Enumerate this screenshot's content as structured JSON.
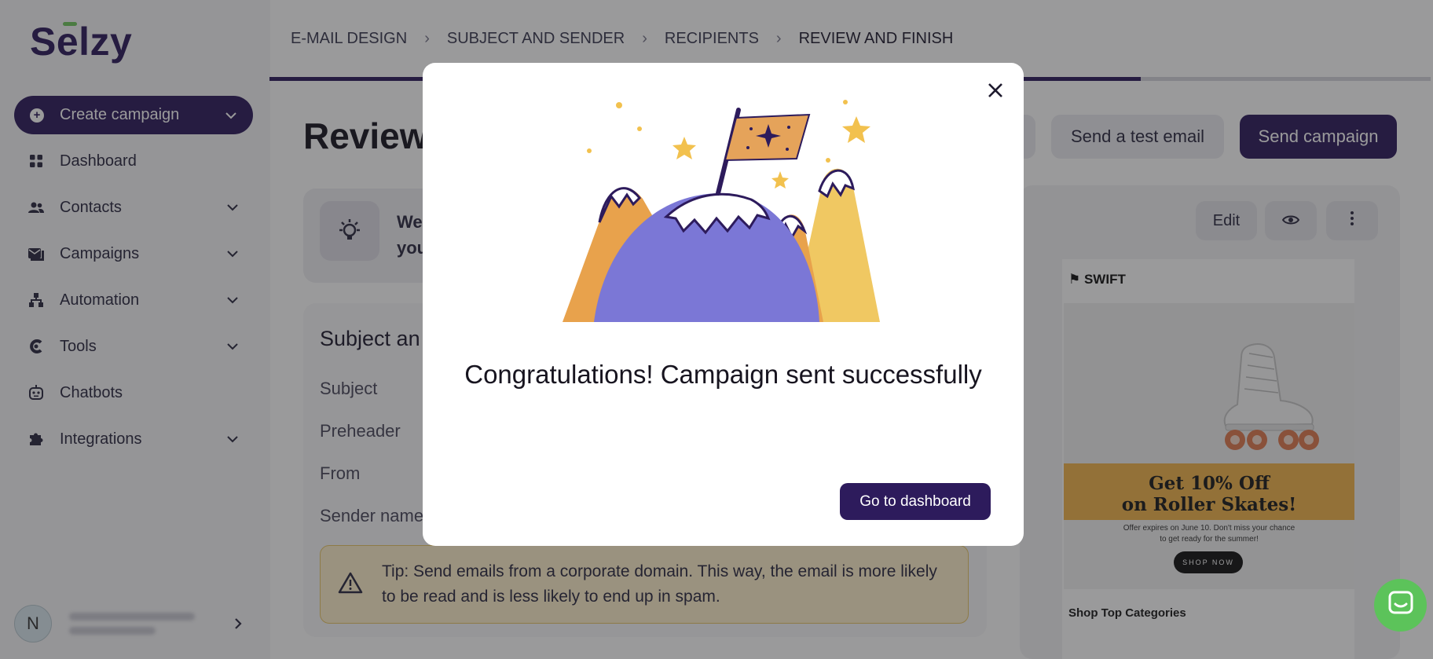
{
  "brand": {
    "name": "Selzy",
    "accent": "#2d1b5c",
    "logo_dash_color": "#6fc75d"
  },
  "sidebar": {
    "create_label": "Create campaign",
    "items": [
      {
        "label": "Dashboard",
        "icon": "dashboard-icon",
        "has_chevron": false
      },
      {
        "label": "Contacts",
        "icon": "contacts-icon",
        "has_chevron": true
      },
      {
        "label": "Campaigns",
        "icon": "campaigns-icon",
        "has_chevron": true
      },
      {
        "label": "Automation",
        "icon": "automation-icon",
        "has_chevron": true
      },
      {
        "label": "Tools",
        "icon": "tools-icon",
        "has_chevron": true
      },
      {
        "label": "Chatbots",
        "icon": "chatbot-icon",
        "has_chevron": false
      },
      {
        "label": "Integrations",
        "icon": "puzzle-icon",
        "has_chevron": true
      }
    ],
    "user": {
      "initial": "N"
    }
  },
  "stepper": {
    "steps": [
      "E-MAIL DESIGN",
      "SUBJECT AND SENDER",
      "RECIPIENTS",
      "REVIEW AND FINISH"
    ],
    "progress": 0.75
  },
  "main": {
    "title": "Review",
    "info_text_line1": "We",
    "info_text_line2": "you",
    "test_email_label": "Send a test email",
    "send_label": "Send campaign",
    "subject_card_title": "Subject an",
    "fields": [
      "Subject",
      "Preheader",
      "From",
      "Sender name"
    ],
    "tip": "Tip: Send emails from a corporate domain. This way, the email is more likely to be read and is less likely to end up in spam."
  },
  "preview": {
    "edit_label": "Edit",
    "brand": "SWIFT",
    "promo_line1": "Get 10% Off",
    "promo_line2": "on Roller Skates!",
    "promo_sub_line1": "Offer expires on June 10. Don't miss your chance",
    "promo_sub_line2": "to get ready for the summer!",
    "shop_now": "SHOP NOW",
    "categories_title": "Shop Top Categories"
  },
  "modal": {
    "title": "Congratulations! Campaign sent successfully",
    "cta": "Go to dashboard"
  }
}
